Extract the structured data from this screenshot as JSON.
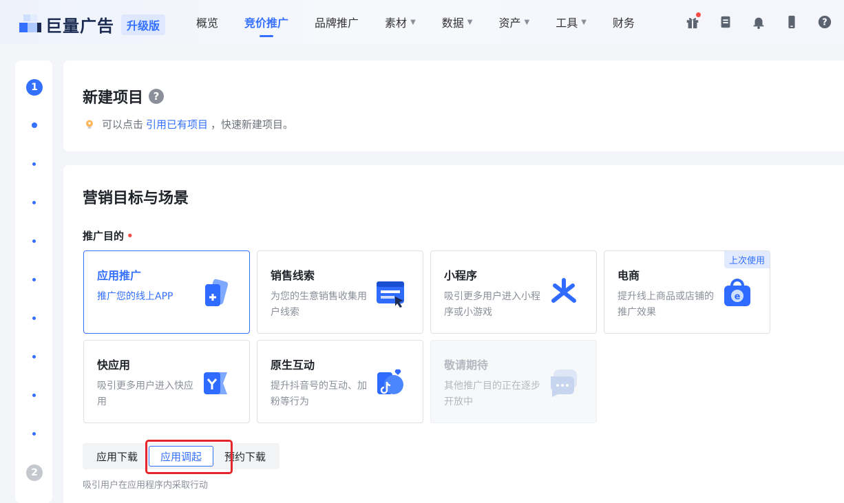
{
  "header": {
    "logo_text": "巨量广告",
    "logo_badge": "升级版",
    "nav": [
      {
        "label": "概览",
        "caret": false
      },
      {
        "label": "竞价推广",
        "caret": false,
        "active": true
      },
      {
        "label": "品牌推广",
        "caret": false
      },
      {
        "label": "素材",
        "caret": true
      },
      {
        "label": "数据",
        "caret": true
      },
      {
        "label": "资产",
        "caret": true
      },
      {
        "label": "工具",
        "caret": true
      },
      {
        "label": "财务",
        "caret": false
      }
    ],
    "icons": [
      "gift-icon",
      "document-icon",
      "bell-icon",
      "phone-icon",
      "help-icon"
    ]
  },
  "rail": {
    "step1": "1",
    "step2": "2"
  },
  "create_card": {
    "title": "新建项目",
    "help": "?",
    "tip_prefix": "可以点击",
    "tip_link": "引用已有项目",
    "tip_suffix": "，快速新建项目。"
  },
  "marketing": {
    "title": "营销目标与场景",
    "field_label": "推广目的",
    "options": [
      {
        "title": "应用推广",
        "desc": "推广您的线上APP",
        "state": "selected",
        "icon": "app-card-icon"
      },
      {
        "title": "销售线索",
        "desc": "为您的生意销售收集用户线索",
        "state": "normal",
        "icon": "web-form-icon"
      },
      {
        "title": "小程序",
        "desc": "吸引更多用户进入小程序或小游戏",
        "state": "normal",
        "icon": "mini-program-icon"
      },
      {
        "title": "电商",
        "desc": "提升线上商品或店铺的推广效果",
        "state": "normal",
        "icon": "shop-bag-icon",
        "tag": "上次使用"
      },
      {
        "title": "快应用",
        "desc": "吸引更多用户进入快应用",
        "state": "normal",
        "icon": "quick-app-icon"
      },
      {
        "title": "原生互动",
        "desc": "提升抖音号的互动、加粉等行为",
        "state": "normal",
        "icon": "douyin-icon"
      },
      {
        "title": "敬请期待",
        "desc": "其他推广目的正在逐步开放中",
        "state": "disabled",
        "icon": "chat-bubble-icon"
      }
    ],
    "segments": [
      "应用下载",
      "应用调起",
      "预约下载"
    ],
    "active_segment": "应用调起",
    "segment_desc": "吸引用户在应用程序内采取行动"
  },
  "colors": {
    "primary": "#3370ff",
    "highlight": "#e5242b"
  }
}
